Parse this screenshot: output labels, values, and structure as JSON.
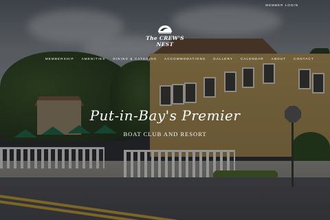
{
  "header": {
    "member_login": "MEMBER LOGIN"
  },
  "logo": {
    "icon": "wave-nest-logo-icon",
    "text": "The CREW'S NEST"
  },
  "nav": {
    "items": [
      {
        "label": "MEMBERSHIP"
      },
      {
        "label": "AMENITIES"
      },
      {
        "label": "DINING & CATERING"
      },
      {
        "label": "ACCOMMODATIONS"
      },
      {
        "label": "GALLERY"
      },
      {
        "label": "CALENDAR"
      },
      {
        "label": "ABOUT"
      },
      {
        "label": "CONTACT"
      }
    ]
  },
  "hero": {
    "title": "Put-in-Bay's Premier",
    "subtitle": "BOAT CLUB AND RESORT"
  },
  "colors": {
    "text": "#ffffff",
    "road_line": "#c9a43a",
    "building": "#b79a5a"
  }
}
